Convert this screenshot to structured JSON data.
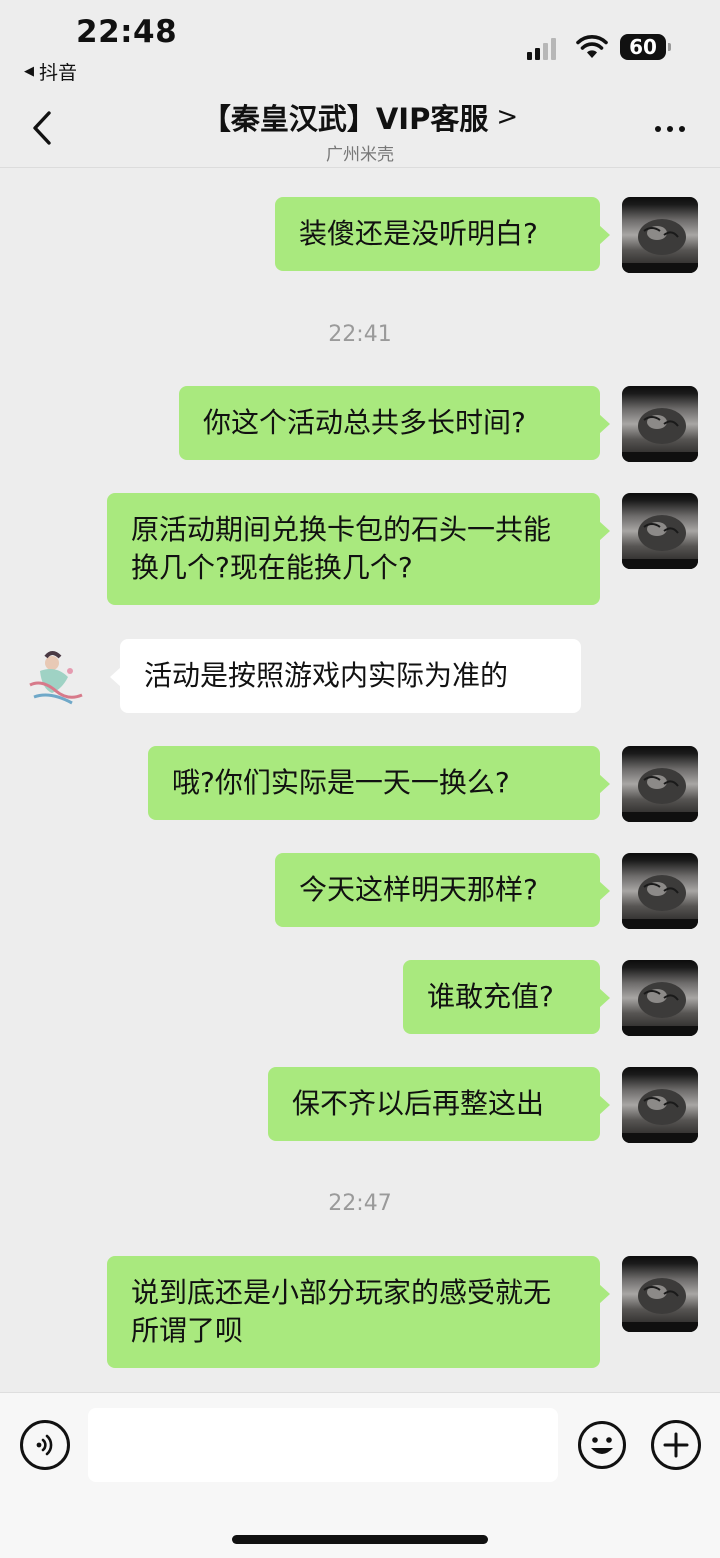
{
  "status_bar": {
    "time": "22:48",
    "back_app": "抖音",
    "battery": "60"
  },
  "header": {
    "title": "【秦皇汉武】VIP客服",
    "title_chevron": ">",
    "subtitle": "广州米壳"
  },
  "messages": [
    {
      "text": "装傻还是没听明白?"
    },
    {
      "timestamp": "22:41"
    },
    {
      "text": "你这个活动总共多长时间?"
    },
    {
      "text": "原活动期间兑换卡包的石头一共能换几个?现在能换几个?"
    },
    {
      "text": "活动是按照游戏内实际为准的"
    },
    {
      "text": "哦?你们实际是一天一换么?"
    },
    {
      "text": "今天这样明天那样?"
    },
    {
      "text": "谁敢充值?"
    },
    {
      "text": "保不齐以后再整这出"
    },
    {
      "timestamp": "22:47"
    },
    {
      "text": "说到底还是小部分玩家的感受就无所谓了呗"
    }
  ],
  "input_bar": {
    "placeholder": ""
  },
  "icons": {
    "back": "chevron-left-icon",
    "more": "more-dots-icon",
    "voice": "voice-icon",
    "emoji": "emoji-icon",
    "plus": "plus-icon"
  },
  "colors": {
    "outgoing_bubble": "#a9e97e",
    "incoming_bubble": "#ffffff",
    "background": "#ededed"
  }
}
